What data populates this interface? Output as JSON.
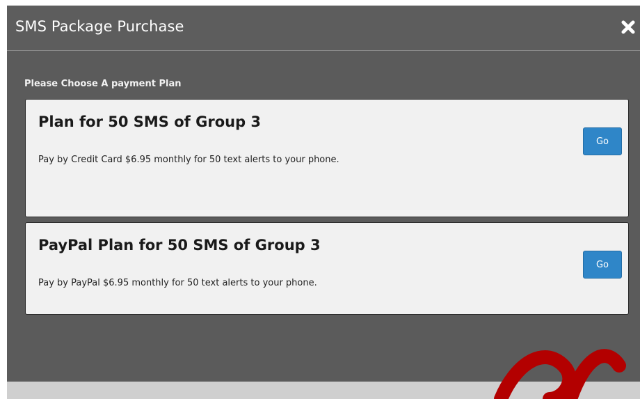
{
  "modal": {
    "title": "SMS Package Purchase",
    "close_icon": "close-icon"
  },
  "instruction": "Please Choose A payment Plan",
  "plans": [
    {
      "title": "Plan for 50 SMS of Group 3",
      "description": "Pay by Credit Card $6.95 monthly for 50 text alerts to your phone.",
      "button_label": "Go"
    },
    {
      "title": "PayPal Plan for 50 SMS of Group 3",
      "description": "Pay by PayPal $6.95 monthly for 50 text alerts to your phone.",
      "button_label": "Go"
    }
  ],
  "colors": {
    "modal_background": "#5b5b5b",
    "card_background": "#f1f1f1",
    "button_accent": "#2f86c8",
    "watermark": "#b30000"
  }
}
